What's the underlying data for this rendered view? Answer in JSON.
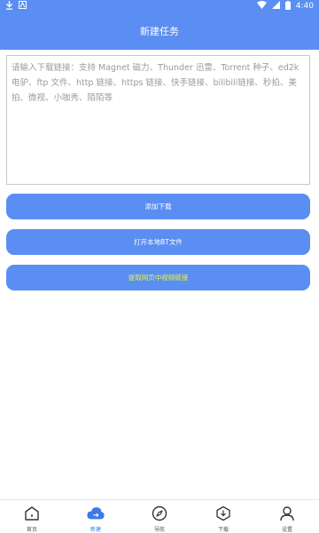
{
  "status_bar": {
    "time": "4:40"
  },
  "header": {
    "title": "新建任务"
  },
  "url_input": {
    "placeholder": "请输入下载链接：支持 Magnet 磁力、Thunder 迅雷、Torrent 种子、ed2k 电驴、ftp 文件、http 链接、https 链接、快手链接、bilibili链接、秒拍、美拍、微视、小咖秀、陌陌等",
    "value": ""
  },
  "buttons": {
    "add_download": "添加下载",
    "open_local_bt": "打开本地BT文件",
    "extract_video_link": "提取网页中视频链接"
  },
  "bottom_nav": {
    "items": [
      {
        "label": "首页",
        "icon": "home-icon",
        "active": false
      },
      {
        "label": "新建",
        "icon": "cloud-icon",
        "active": true
      },
      {
        "label": "导航",
        "icon": "compass-icon",
        "active": false
      },
      {
        "label": "下载",
        "icon": "download-icon",
        "active": false
      },
      {
        "label": "设置",
        "icon": "user-icon",
        "active": false
      }
    ]
  },
  "colors": {
    "primary": "#5b8ef2",
    "active_nav": "#3a7ae8",
    "highlight_text": "#e7f542"
  }
}
